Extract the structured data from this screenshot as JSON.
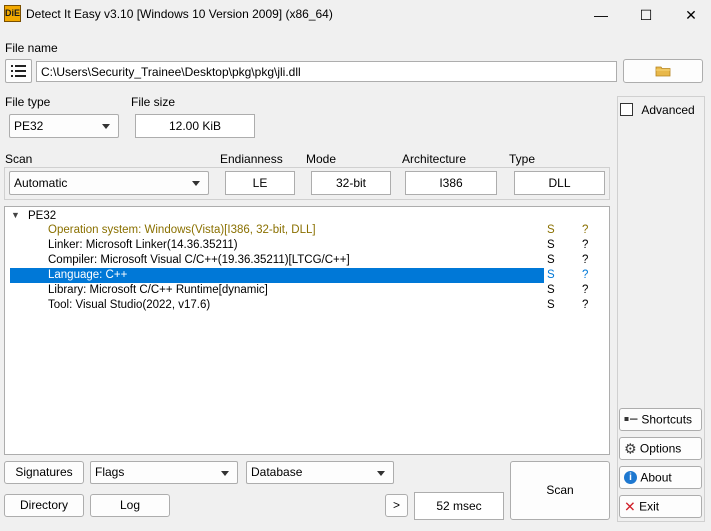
{
  "window": {
    "title": "Detect It Easy v3.10 [Windows 10 Version 2009] (x86_64)",
    "icon_text": "DiE",
    "minimize": "—",
    "maximize": "☐",
    "close": "✕"
  },
  "file": {
    "label": "File name",
    "path": "C:\\Users\\Security_Trainee\\Desktop\\pkg\\pkg\\jli.dll"
  },
  "file_type": {
    "label": "File type",
    "value": "PE32"
  },
  "file_size": {
    "label": "File size",
    "value": "12.00 KiB"
  },
  "scan": {
    "label": "Scan",
    "value": "Automatic"
  },
  "endianness": {
    "label": "Endianness",
    "value": "LE"
  },
  "mode": {
    "label": "Mode",
    "value": "32-bit"
  },
  "architecture": {
    "label": "Architecture",
    "value": "I386"
  },
  "type": {
    "label": "Type",
    "value": "DLL"
  },
  "advanced": {
    "label": "Advanced",
    "checked": false
  },
  "tree": {
    "root": "PE32",
    "rows": [
      {
        "text": "Operation system: Windows(Vista)[I386, 32-bit, DLL]",
        "s": "S",
        "q": "?"
      },
      {
        "text": "Linker: Microsoft Linker(14.36.35211)",
        "s": "S",
        "q": "?"
      },
      {
        "text": "Compiler: Microsoft Visual C/C++(19.36.35211)[LTCG/C++]",
        "s": "S",
        "q": "?"
      },
      {
        "text": "Language: C++",
        "s": "S",
        "q": "?"
      },
      {
        "text": "Library: Microsoft C/C++ Runtime[dynamic]",
        "s": "S",
        "q": "?"
      },
      {
        "text": "Tool: Visual Studio(2022, v17.6)",
        "s": "S",
        "q": "?"
      }
    ]
  },
  "side": {
    "shortcuts": "Shortcuts",
    "options": "Options",
    "about": "About",
    "exit": "Exit"
  },
  "bottom": {
    "signatures": "Signatures",
    "flags": "Flags",
    "database": "Database",
    "directory": "Directory",
    "log": "Log",
    "more": ">",
    "time": "52 msec",
    "scan": "Scan"
  },
  "colors": {
    "os_row": "#8a7000",
    "selection": "#0078d7",
    "s_flag": "#000000"
  }
}
